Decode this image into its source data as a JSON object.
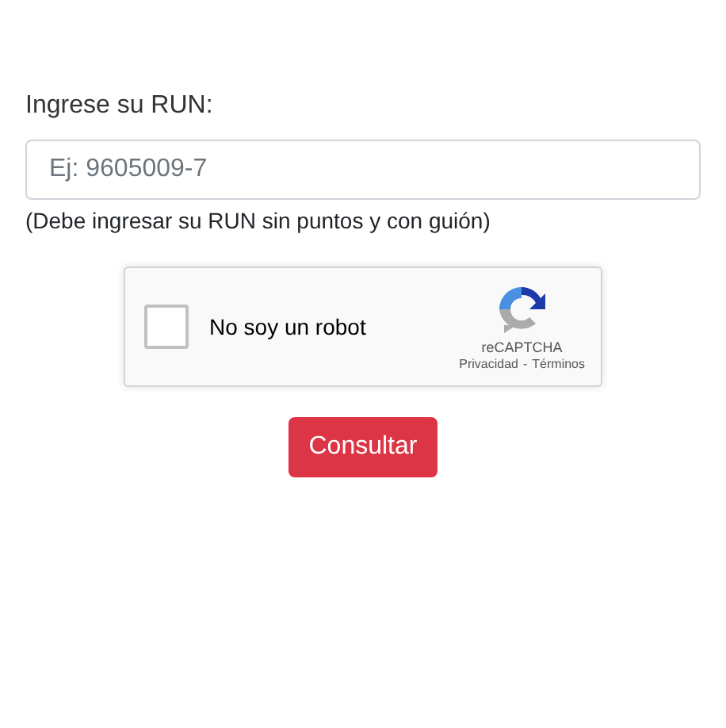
{
  "form": {
    "label": "Ingrese su RUN:",
    "run_field": {
      "placeholder": "Ej: 9605009-7"
    },
    "help": "(Debe ingresar su RUN sin puntos y con guión)"
  },
  "captcha": {
    "checkbox_label": "No soy un robot",
    "checked": false,
    "brand": "reCAPTCHA",
    "links": [
      "Privacidad",
      "Términos"
    ],
    "separator": "-"
  },
  "submit": "Consultar"
}
